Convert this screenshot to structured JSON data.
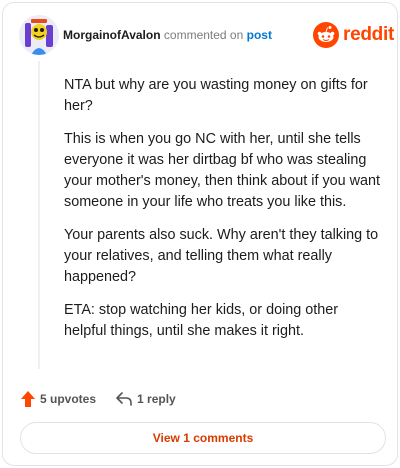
{
  "comment": {
    "username": "MorgainofAvalon",
    "verb": "commented on",
    "post_link": "post",
    "paragraphs": [
      "NTA but why are you wasting money on gifts for her?",
      "This is when you go NC with her, until she tells everyone it was her dirtbag bf who was stealing your mother's money, then think about if you want someone in your life who treats you like this.",
      "Your parents also suck. Why aren't they talking to your relatives, and telling them what really happened?",
      "ETA: stop watching her kids, or doing other helpful things, until she makes it right."
    ]
  },
  "brand": {
    "name": "reddit",
    "color": "#ff4500"
  },
  "actions": {
    "upvotes": "5 upvotes",
    "reply": "1 reply"
  },
  "view_comments": "View 1 comments"
}
